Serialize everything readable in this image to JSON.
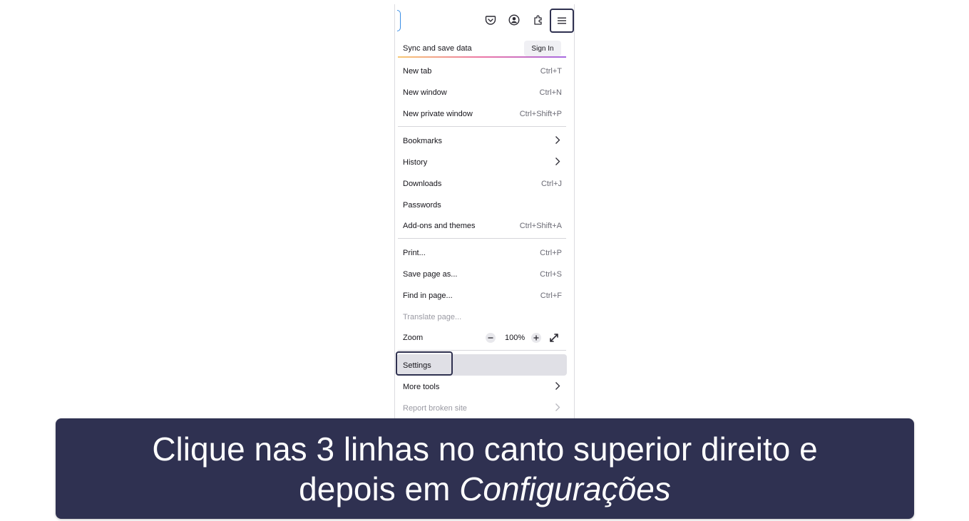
{
  "toolbar": {
    "icons": [
      "pocket-icon",
      "account-icon",
      "extensions-icon",
      "hamburger-menu-icon"
    ]
  },
  "sync": {
    "label": "Sync and save data",
    "sign_in": "Sign In"
  },
  "menu": {
    "new_tab": {
      "label": "New tab",
      "shortcut": "Ctrl+T"
    },
    "new_window": {
      "label": "New window",
      "shortcut": "Ctrl+N"
    },
    "new_private_window": {
      "label": "New private window",
      "shortcut": "Ctrl+Shift+P"
    },
    "bookmarks": {
      "label": "Bookmarks"
    },
    "history": {
      "label": "History"
    },
    "downloads": {
      "label": "Downloads",
      "shortcut": "Ctrl+J"
    },
    "passwords": {
      "label": "Passwords"
    },
    "addons": {
      "label": "Add-ons and themes",
      "shortcut": "Ctrl+Shift+A"
    },
    "print": {
      "label": "Print...",
      "shortcut": "Ctrl+P"
    },
    "save_page": {
      "label": "Save page as...",
      "shortcut": "Ctrl+S"
    },
    "find": {
      "label": "Find in page...",
      "shortcut": "Ctrl+F"
    },
    "translate": {
      "label": "Translate page..."
    },
    "zoom": {
      "label": "Zoom",
      "value": "100%"
    },
    "settings": {
      "label": "Settings"
    },
    "more_tools": {
      "label": "More tools"
    },
    "report": {
      "label": "Report broken site"
    }
  },
  "caption": {
    "line1": "Clique nas 3 linhas no canto superior direito e",
    "line2_prefix": "depois em ",
    "line2_emph": "Configurações"
  },
  "colors": {
    "highlight_border": "#2f3150",
    "caption_bg": "#2f3151",
    "url_border": "#3a8ee6"
  }
}
